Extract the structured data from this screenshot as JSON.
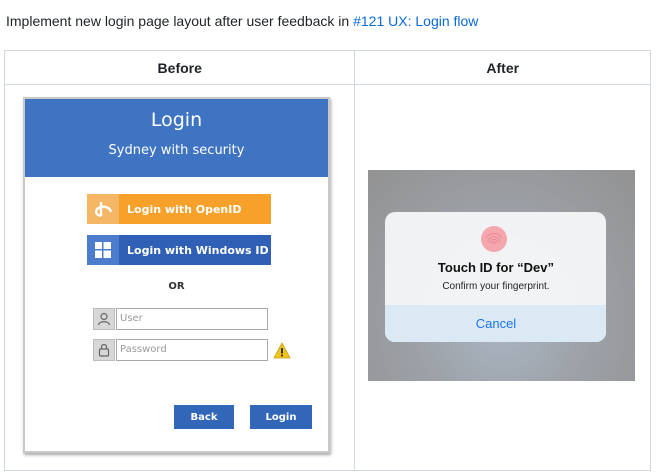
{
  "intro": {
    "text": "Implement new login page layout after user feedback in ",
    "link": "#121 UX: Login flow"
  },
  "table": {
    "headers": [
      "Before",
      "After"
    ]
  },
  "before": {
    "title": "Login",
    "subtitle": "Sydney with security",
    "openid_label": "Login with OpenID",
    "windows_label": "Login with Windows ID",
    "or_label": "OR",
    "user_placeholder": "User",
    "password_placeholder": "Password",
    "back_label": "Back",
    "login_label": "Login",
    "colors": {
      "header": "#3f74c2",
      "openid": "#f7a02a",
      "windows": "#2f60b6",
      "buttons": "#3266b9"
    },
    "icons": [
      "openid-icon",
      "windows-icon",
      "user-icon",
      "lock-icon",
      "warning-icon"
    ]
  },
  "after": {
    "title": "Touch ID for “Dev”",
    "subtitle": "Confirm your fingerprint.",
    "cancel_label": "Cancel",
    "icons": [
      "fingerprint-icon"
    ]
  }
}
